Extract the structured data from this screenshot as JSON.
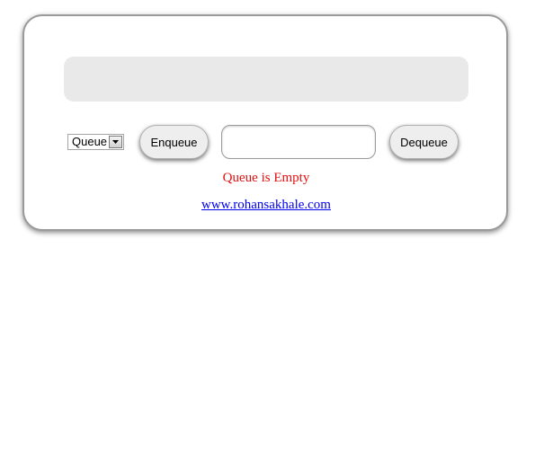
{
  "display": {
    "contents": ""
  },
  "controls": {
    "mode_select": {
      "selected": "Queue",
      "icon": "chevron-down-icon"
    },
    "enqueue_label": "Enqueue",
    "value_input": {
      "value": "",
      "placeholder": ""
    },
    "dequeue_label": "Dequeue"
  },
  "status": {
    "text": "Queue is Empty",
    "color": "#e01010"
  },
  "footer": {
    "link_text": "www.rohansakhale.com",
    "link_color": "#0000ee"
  }
}
